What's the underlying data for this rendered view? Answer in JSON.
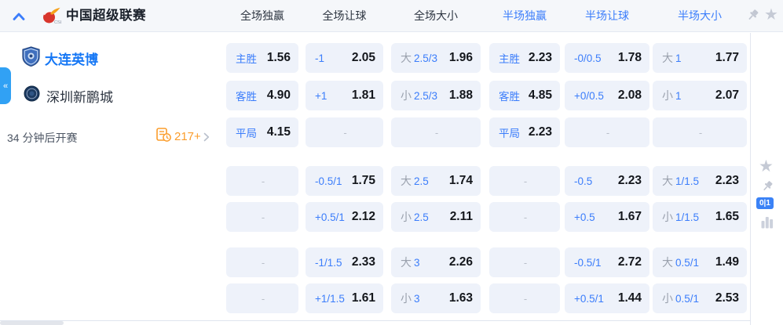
{
  "header": {
    "league_title": "中国超级联赛",
    "columns": [
      {
        "label": "全场独赢",
        "highlighted": false
      },
      {
        "label": "全场让球",
        "highlighted": false
      },
      {
        "label": "全场大小",
        "highlighted": false
      },
      {
        "label": "半场独赢",
        "highlighted": true
      },
      {
        "label": "半场让球",
        "highlighted": true
      },
      {
        "label": "半场大小",
        "highlighted": true
      }
    ]
  },
  "match": {
    "home_team": "大连英博",
    "away_team": "深圳新鹏城",
    "kickoff_text": "34 分钟后开赛",
    "extra_markets_count": "217+",
    "score_badge": "0|1"
  },
  "icons": {
    "collapse_glyph": "«",
    "star_glyph": "★"
  },
  "colors": {
    "accent_blue": "#3b7dfb",
    "tab_blue": "#31a1f4",
    "badge_blue": "#3b82f6",
    "orange": "#fb9d2c",
    "cell_bg": "#eef2fa",
    "header_bg": "#f5f7fa"
  },
  "odds_rows": [
    {
      "cells": [
        {
          "num": "主胜",
          "val": "1.56"
        },
        {
          "num": "-1",
          "val": "2.05"
        },
        {
          "pre": "大",
          "num": "2.5/3",
          "val": "1.96"
        },
        {
          "num": "主胜",
          "val": "2.23"
        },
        {
          "num": "-0/0.5",
          "val": "1.78"
        },
        {
          "pre": "大",
          "num": "1",
          "val": "1.77"
        }
      ]
    },
    {
      "cells": [
        {
          "num": "客胜",
          "val": "4.90"
        },
        {
          "num": "+1",
          "val": "1.81"
        },
        {
          "pre": "小",
          "num": "2.5/3",
          "val": "1.88"
        },
        {
          "num": "客胜",
          "val": "4.85"
        },
        {
          "num": "+0/0.5",
          "val": "2.08"
        },
        {
          "pre": "小",
          "num": "1",
          "val": "2.07"
        }
      ]
    },
    {
      "cells": [
        {
          "num": "平局",
          "val": "4.15"
        },
        {
          "dash": "-"
        },
        {
          "dash": "-"
        },
        {
          "num": "平局",
          "val": "2.23"
        },
        {
          "dash": "-"
        },
        {
          "dash": "-"
        }
      ]
    },
    {
      "cells": [
        {
          "dash": "-"
        },
        {
          "num": "-0.5/1",
          "val": "1.75"
        },
        {
          "pre": "大",
          "num": "2.5",
          "val": "1.74"
        },
        {
          "dash": "-"
        },
        {
          "num": "-0.5",
          "val": "2.23"
        },
        {
          "pre": "大",
          "num": "1/1.5",
          "val": "2.23"
        }
      ]
    },
    {
      "cells": [
        {
          "dash": "-"
        },
        {
          "num": "+0.5/1",
          "val": "2.12"
        },
        {
          "pre": "小",
          "num": "2.5",
          "val": "2.11"
        },
        {
          "dash": "-"
        },
        {
          "num": "+0.5",
          "val": "1.67"
        },
        {
          "pre": "小",
          "num": "1/1.5",
          "val": "1.65"
        }
      ]
    },
    {
      "cells": [
        {
          "dash": "-"
        },
        {
          "num": "-1/1.5",
          "val": "2.33"
        },
        {
          "pre": "大",
          "num": "3",
          "val": "2.26"
        },
        {
          "dash": "-"
        },
        {
          "num": "-0.5/1",
          "val": "2.72"
        },
        {
          "pre": "大",
          "num": "0.5/1",
          "val": "1.49"
        }
      ]
    },
    {
      "cells": [
        {
          "dash": "-"
        },
        {
          "num": "+1/1.5",
          "val": "1.61"
        },
        {
          "pre": "小",
          "num": "3",
          "val": "1.63"
        },
        {
          "dash": "-"
        },
        {
          "num": "+0.5/1",
          "val": "1.44"
        },
        {
          "pre": "小",
          "num": "0.5/1",
          "val": "2.53"
        }
      ]
    }
  ]
}
